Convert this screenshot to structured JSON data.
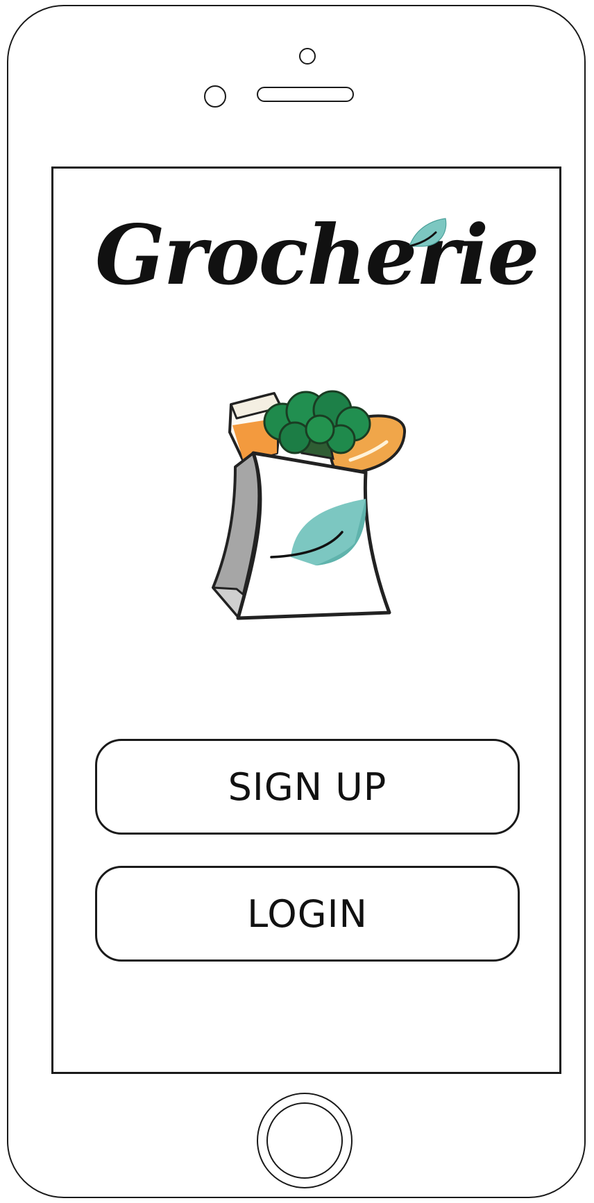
{
  "app": {
    "name": "Grocherie"
  },
  "device": {
    "home_button_icon": "home-button",
    "camera_icon": "front-camera-icon"
  },
  "branding": {
    "logo_text": "Grocherie",
    "leaf_color": "#7cc7c1",
    "illustration": "grocery-bag-icon"
  },
  "actions": {
    "signup_label": "SIGN UP",
    "login_label": "LOGIN"
  }
}
